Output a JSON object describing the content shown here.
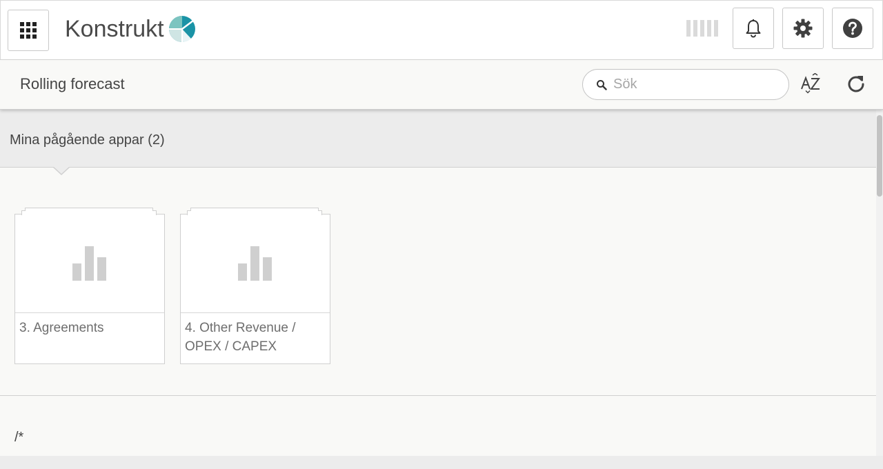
{
  "app": {
    "brand_name": "Konstrukt",
    "icons": {
      "apps": "apps-grid-icon",
      "logo": "konstrukt-logo-icon",
      "busy": "busy-indicator",
      "notifications": "bell-icon",
      "settings": "gear-icon",
      "help": "help-icon"
    }
  },
  "sheet": {
    "title": "Rolling forecast",
    "search": {
      "placeholder": "Sök",
      "value": ""
    },
    "sort_icon": "sort-az-icon",
    "refresh_icon": "refresh-icon"
  },
  "section": {
    "title": "Mina pågående appar (2)",
    "tiles": [
      {
        "label": "3. Agreements",
        "icon": "bar-chart-icon"
      },
      {
        "label": "4. Other Revenue / OPEX / CAPEX",
        "icon": "bar-chart-icon"
      }
    ]
  },
  "footer": {
    "text": "/*"
  },
  "colors": {
    "accent_teal": "#1a93a6",
    "accent_light": "#7cc4c0",
    "background": "#f9f9f7",
    "section_bg": "#ececec"
  }
}
